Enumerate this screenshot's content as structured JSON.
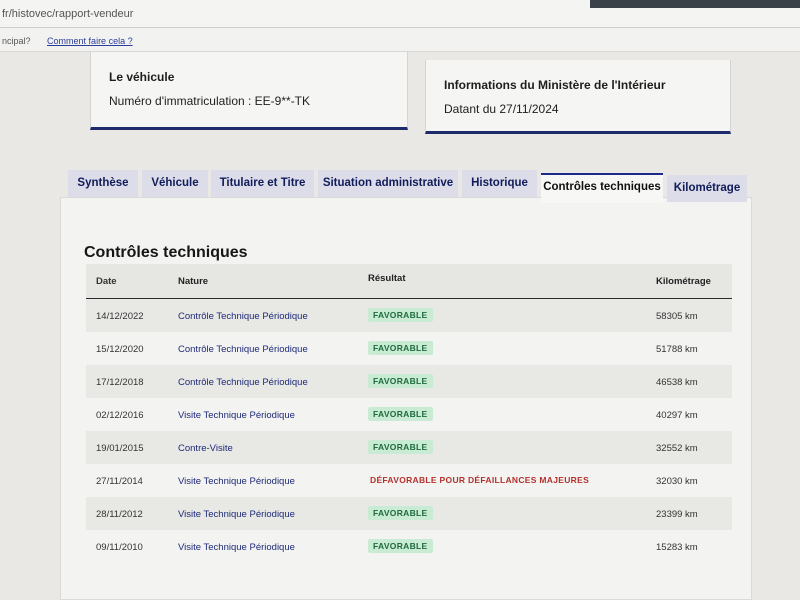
{
  "browser": {
    "url": "fr/histovec/rapport-vendeur"
  },
  "helpbar": {
    "prefix": "ncipal?",
    "link": "Comment faire cela ?"
  },
  "vehicle_card": {
    "title": "Le véhicule",
    "plate": "Numéro d'immatriculation : EE-9**-TK"
  },
  "ministry_card": {
    "title": "Informations du Ministère de l'Intérieur",
    "date": "Datant du 27/11/2024"
  },
  "tabs": [
    {
      "label": "Synthèse"
    },
    {
      "label": "Véhicule"
    },
    {
      "label": "Titulaire et Titre"
    },
    {
      "label": "Situation administrative"
    },
    {
      "label": "Historique"
    },
    {
      "label": "Contrôles techniques"
    },
    {
      "label": "Kilométrage"
    }
  ],
  "active_tab": "Contrôles techniques",
  "section": {
    "title": "Contrôles techniques"
  },
  "table": {
    "headers": {
      "date": "Date",
      "nature": "Nature",
      "result": "Résultat",
      "km": "Kilométrage"
    },
    "rows": [
      {
        "date": "14/12/2022",
        "nature": "Contrôle Technique Périodique",
        "result": "FAVORABLE",
        "km": "58305 km"
      },
      {
        "date": "15/12/2020",
        "nature": "Contrôle Technique Périodique",
        "result": "FAVORABLE",
        "km": "51788 km"
      },
      {
        "date": "17/12/2018",
        "nature": "Contrôle Technique Périodique",
        "result": "FAVORABLE",
        "km": "46538 km"
      },
      {
        "date": "02/12/2016",
        "nature": "Visite Technique Périodique",
        "result": "FAVORABLE",
        "km": "40297 km"
      },
      {
        "date": "19/01/2015",
        "nature": "Contre-Visite",
        "result": "FAVORABLE",
        "km": "32552 km"
      },
      {
        "date": "27/11/2014",
        "nature": "Visite Technique Périodique",
        "result": "DÉFAVORABLE POUR DÉFAILLANCES MAJEURES",
        "km": "32030 km"
      },
      {
        "date": "28/11/2012",
        "nature": "Visite Technique Périodique",
        "result": "FAVORABLE",
        "km": "23399 km"
      },
      {
        "date": "09/11/2010",
        "nature": "Visite Technique Périodique",
        "result": "FAVORABLE",
        "km": "15283 km"
      }
    ]
  },
  "colors": {
    "accent": "#1d2a6b",
    "favorable_bg": "#c9ebd4",
    "favorable_text": "#1f6b3d",
    "defavorable_text": "#b3312d"
  }
}
